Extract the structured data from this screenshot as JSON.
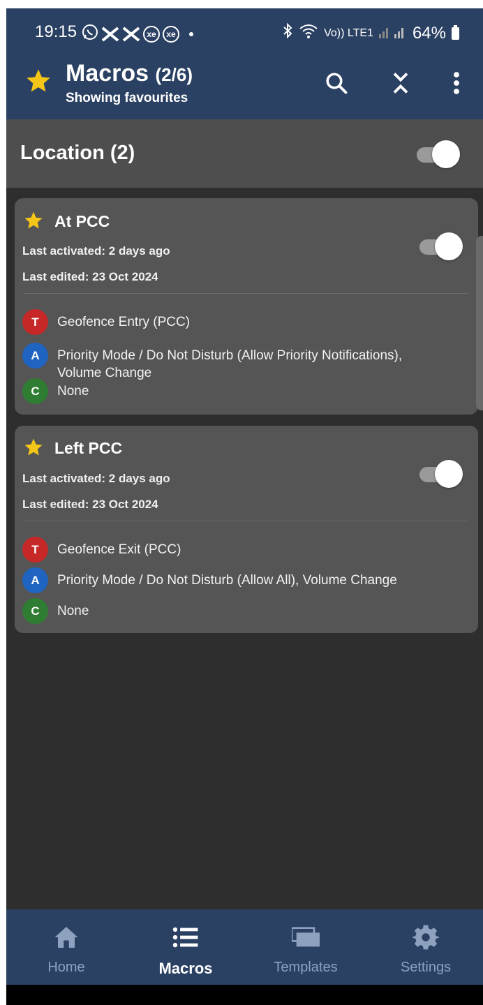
{
  "status_bar": {
    "time": "19:15",
    "left_icons": [
      "whatsapp-icon",
      "halifax-icon",
      "halifax-icon",
      "xe-icon",
      "xe-icon"
    ],
    "halifax_label": "HALIFAX",
    "xe_label": "xe",
    "volte_label": "Vo)) LTE1",
    "battery": "64%"
  },
  "app_bar": {
    "title": "Macros",
    "count": "(2/6)",
    "subtitle": "Showing favourites",
    "actions": [
      "search-icon",
      "collapse-icon",
      "more-icon"
    ]
  },
  "category": {
    "title": "Location (2)",
    "enabled": true
  },
  "macros": [
    {
      "name": "At PCC",
      "last_activated": "Last activated: 2 days ago",
      "last_edited": "Last edited: 23 Oct 2024",
      "enabled": true,
      "trigger_letter": "T",
      "trigger": "Geofence Entry (PCC)",
      "action_letter": "A",
      "action": "Priority Mode / Do Not Disturb (Allow Priority Notifications), Volume Change",
      "constraint_letter": "C",
      "constraint": "None"
    },
    {
      "name": "Left PCC",
      "last_activated": "Last activated: 2 days ago",
      "last_edited": "Last edited: 23 Oct 2024",
      "enabled": true,
      "trigger_letter": "T",
      "trigger": "Geofence Exit (PCC)",
      "action_letter": "A",
      "action": "Priority Mode / Do Not Disturb (Allow All), Volume Change",
      "constraint_letter": "C",
      "constraint": "None"
    }
  ],
  "bottom_nav": {
    "items": [
      {
        "label": "Home",
        "icon": "home-icon",
        "active": false
      },
      {
        "label": "Macros",
        "icon": "list-icon",
        "active": true
      },
      {
        "label": "Templates",
        "icon": "templates-icon",
        "active": false
      },
      {
        "label": "Settings",
        "icon": "gear-icon",
        "active": false
      }
    ]
  },
  "colors": {
    "header": "#2b4163",
    "background": "#2e2e2e",
    "card": "#555555",
    "star": "#f5c518",
    "trigger": "#c62828",
    "action": "#1e64c0",
    "constraint": "#2e7d32"
  }
}
